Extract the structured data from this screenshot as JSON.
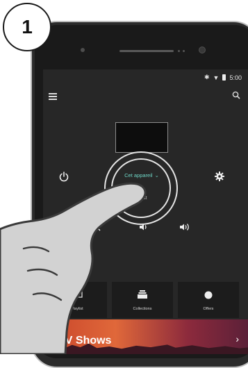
{
  "step": {
    "number": "1"
  },
  "status_bar": {
    "time": "5:00"
  },
  "remote": {
    "device_label": "Cet appareil",
    "cast_label": "Broadcast"
  },
  "tiles": [
    {
      "label": "Playlist",
      "icon": "tv-icon"
    },
    {
      "label": "Collections",
      "icon": "stack-icon"
    },
    {
      "label": "Offers",
      "icon": "badge-icon"
    }
  ],
  "banner": {
    "title": "TV Shows"
  },
  "colors": {
    "accent": "#6fd7c7",
    "screen_bg": "#272727",
    "banner_start": "#c8442a",
    "banner_end": "#5a2038"
  }
}
